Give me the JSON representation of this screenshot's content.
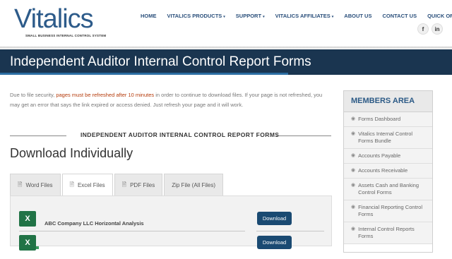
{
  "logo": {
    "text": "Vitalics",
    "tagline": "SMALL BUSINESS INTERNAL CONTROL SYSTEM"
  },
  "nav": [
    {
      "label": "HOME",
      "dropdown": false
    },
    {
      "label": "VITALICS PRODUCTS",
      "dropdown": true
    },
    {
      "label": "SUPPORT",
      "dropdown": true
    },
    {
      "label": "VITALICS AFFILIATES",
      "dropdown": true
    },
    {
      "label": "ABOUT US",
      "dropdown": false
    },
    {
      "label": "CONTACT US",
      "dropdown": false
    },
    {
      "label": "QUICK ORDERING",
      "dropdown": false
    }
  ],
  "nav_caret": "▾",
  "social": {
    "facebook": "f",
    "linkedin": "in"
  },
  "page_title": "Independent Auditor Internal Control Report Forms",
  "notice": {
    "part1": "Due to file security, ",
    "highlight": "pages must be refreshed after 10 minutes",
    "part2": " in order to continue to download files.  If your page is not refreshed, you may get an error that says the link expired or access denied. Just refresh your page and it will work."
  },
  "section_heading": "INDEPENDENT AUDITOR INTERNAL CONTROL REPORT FORMS",
  "download_heading": "Download Individually",
  "tabs": [
    {
      "label": "Word Files",
      "icon": "word-file-icon",
      "active": false
    },
    {
      "label": "Excel Files",
      "icon": "excel-file-icon",
      "active": true
    },
    {
      "label": "PDF Files",
      "icon": "pdf-file-icon",
      "active": false
    },
    {
      "label": "Zip File (All Files)",
      "icon": "",
      "active": false
    }
  ],
  "files": [
    {
      "name": "ABC Company LLC Horizontal Analysis",
      "button": "Download",
      "icon_letter": "X"
    },
    {
      "name": "",
      "button": "Download",
      "icon_letter": "X"
    }
  ],
  "sidebar": {
    "title": "MEMBERS AREA",
    "items": [
      "Forms Dashboard",
      "Vitalics Internal Control Forms Bundle",
      "Accounts Payable",
      "Accounts Receivable",
      "Assets Cash and Banking Control Forms",
      "Financial Reporting Control Forms",
      "Internal Control Reports Forms"
    ]
  },
  "colors": {
    "brand": "#2d5b8a",
    "title_bar": "#1a3550",
    "button": "#1a4a72",
    "highlight": "#b53a0a"
  }
}
